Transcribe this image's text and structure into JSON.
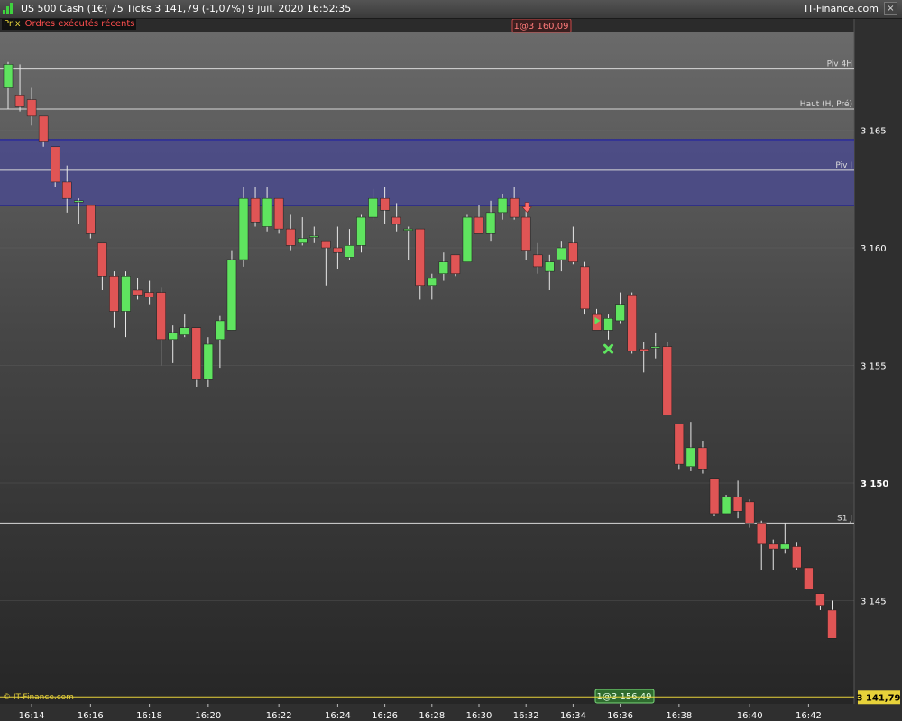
{
  "header": {
    "title": "US 500 Cash (1€)   75 Ticks   3 141,79 (-1,07%)   9 juil. 2020 16:52:35",
    "brand": "IT-Finance.com",
    "close_icon": "close-icon"
  },
  "tags": {
    "price": "Prix",
    "orders": "Ordres exécutés récents"
  },
  "orders": {
    "top": "1@3 160,09",
    "bottom": "1@3 156,49"
  },
  "footer_brand": "© IT-Finance.com",
  "colors": {
    "up": "#5fe45f",
    "down": "#e05555",
    "pivot_zone": "#4a4a8c",
    "price_line": "#e7d23a"
  },
  "chart_data": {
    "type": "candlestick",
    "instrument": "US 500 Cash (1€)",
    "interval": "75 Ticks",
    "last_price": "3 141,79",
    "last_price_value": 3141.79,
    "y_ticks": [
      {
        "v": 3165,
        "label": "3 165",
        "bold": false
      },
      {
        "v": 3160,
        "label": "3 160",
        "bold": false
      },
      {
        "v": 3155,
        "label": "3 155",
        "bold": false
      },
      {
        "v": 3150,
        "label": "3 150",
        "bold": true
      },
      {
        "v": 3145,
        "label": "3 145",
        "bold": false
      }
    ],
    "x_labels": [
      {
        "i": 2,
        "label": "16:14"
      },
      {
        "i": 7,
        "label": "16:16"
      },
      {
        "i": 12,
        "label": "16:18"
      },
      {
        "i": 17,
        "label": "16:20"
      },
      {
        "i": 23,
        "label": "16:22"
      },
      {
        "i": 28,
        "label": "16:24"
      },
      {
        "i": 32,
        "label": "16:26"
      },
      {
        "i": 36,
        "label": "16:28"
      },
      {
        "i": 40,
        "label": "16:30"
      },
      {
        "i": 44,
        "label": "16:32"
      },
      {
        "i": 48,
        "label": "16:34"
      },
      {
        "i": 52,
        "label": "16:36"
      },
      {
        "i": 57,
        "label": "16:38"
      },
      {
        "i": 63,
        "label": "16:40"
      },
      {
        "i": 68,
        "label": "16:42"
      }
    ],
    "levels": [
      {
        "name": "Piv 4H",
        "value": 3167.6
      },
      {
        "name": "Haut (H, Pré)",
        "value": 3165.9
      },
      {
        "name": "Piv J",
        "value": 3163.3
      },
      {
        "name": "S1 J",
        "value": 3148.3
      }
    ],
    "zone": {
      "top": 3164.6,
      "bottom": 3161.8
    },
    "candles": [
      {
        "o": 3166.8,
        "h": 3167.9,
        "l": 3165.9,
        "c": 3167.8
      },
      {
        "o": 3166.5,
        "h": 3167.8,
        "l": 3165.8,
        "c": 3166.0
      },
      {
        "o": 3166.3,
        "h": 3166.8,
        "l": 3165.2,
        "c": 3165.6
      },
      {
        "o": 3165.6,
        "h": 3165.6,
        "l": 3164.3,
        "c": 3164.5
      },
      {
        "o": 3164.3,
        "h": 3164.3,
        "l": 3162.6,
        "c": 3162.8
      },
      {
        "o": 3162.8,
        "h": 3163.5,
        "l": 3161.5,
        "c": 3162.1
      },
      {
        "o": 3162.0,
        "h": 3162.1,
        "l": 3161.0,
        "c": 3162.0
      },
      {
        "o": 3161.8,
        "h": 3161.8,
        "l": 3160.4,
        "c": 3160.6
      },
      {
        "o": 3160.2,
        "h": 3160.2,
        "l": 3158.2,
        "c": 3158.8
      },
      {
        "o": 3158.8,
        "h": 3159.0,
        "l": 3156.6,
        "c": 3157.3
      },
      {
        "o": 3157.3,
        "h": 3159.0,
        "l": 3156.2,
        "c": 3158.8
      },
      {
        "o": 3158.2,
        "h": 3158.7,
        "l": 3157.8,
        "c": 3158.0
      },
      {
        "o": 3158.1,
        "h": 3158.6,
        "l": 3157.6,
        "c": 3157.9
      },
      {
        "o": 3158.1,
        "h": 3158.3,
        "l": 3155.0,
        "c": 3156.1
      },
      {
        "o": 3156.1,
        "h": 3156.7,
        "l": 3155.1,
        "c": 3156.4
      },
      {
        "o": 3156.3,
        "h": 3157.2,
        "l": 3156.2,
        "c": 3156.6
      },
      {
        "o": 3156.6,
        "h": 3156.6,
        "l": 3154.1,
        "c": 3154.4
      },
      {
        "o": 3154.4,
        "h": 3156.2,
        "l": 3154.1,
        "c": 3155.9
      },
      {
        "o": 3156.1,
        "h": 3157.1,
        "l": 3154.9,
        "c": 3156.9
      },
      {
        "o": 3156.5,
        "h": 3159.9,
        "l": 3156.5,
        "c": 3159.5
      },
      {
        "o": 3159.5,
        "h": 3162.6,
        "l": 3159.2,
        "c": 3162.1
      },
      {
        "o": 3162.1,
        "h": 3162.6,
        "l": 3160.9,
        "c": 3161.1
      },
      {
        "o": 3160.9,
        "h": 3162.6,
        "l": 3160.7,
        "c": 3162.1
      },
      {
        "o": 3162.1,
        "h": 3162.1,
        "l": 3160.6,
        "c": 3160.8
      },
      {
        "o": 3160.8,
        "h": 3161.4,
        "l": 3159.9,
        "c": 3160.1
      },
      {
        "o": 3160.2,
        "h": 3161.3,
        "l": 3160.1,
        "c": 3160.4
      },
      {
        "o": 3160.5,
        "h": 3160.9,
        "l": 3160.2,
        "c": 3160.5
      },
      {
        "o": 3160.3,
        "h": 3160.3,
        "l": 3158.4,
        "c": 3160.0
      },
      {
        "o": 3160.0,
        "h": 3160.9,
        "l": 3159.1,
        "c": 3159.8
      },
      {
        "o": 3159.6,
        "h": 3160.8,
        "l": 3159.5,
        "c": 3160.1
      },
      {
        "o": 3160.1,
        "h": 3161.4,
        "l": 3159.8,
        "c": 3161.3
      },
      {
        "o": 3161.3,
        "h": 3162.5,
        "l": 3161.2,
        "c": 3162.1
      },
      {
        "o": 3162.1,
        "h": 3162.6,
        "l": 3161.0,
        "c": 3161.6
      },
      {
        "o": 3161.3,
        "h": 3161.9,
        "l": 3160.7,
        "c": 3161.0
      },
      {
        "o": 3160.8,
        "h": 3160.9,
        "l": 3159.5,
        "c": 3160.8
      },
      {
        "o": 3160.8,
        "h": 3160.8,
        "l": 3157.8,
        "c": 3158.4
      },
      {
        "o": 3158.4,
        "h": 3158.9,
        "l": 3157.8,
        "c": 3158.7
      },
      {
        "o": 3158.9,
        "h": 3159.8,
        "l": 3158.6,
        "c": 3159.4
      },
      {
        "o": 3159.7,
        "h": 3159.7,
        "l": 3158.8,
        "c": 3158.9
      },
      {
        "o": 3159.4,
        "h": 3161.4,
        "l": 3159.4,
        "c": 3161.3
      },
      {
        "o": 3161.3,
        "h": 3161.8,
        "l": 3160.6,
        "c": 3160.6
      },
      {
        "o": 3160.6,
        "h": 3162.0,
        "l": 3160.3,
        "c": 3161.5
      },
      {
        "o": 3161.5,
        "h": 3162.3,
        "l": 3161.2,
        "c": 3162.1
      },
      {
        "o": 3162.1,
        "h": 3162.6,
        "l": 3161.2,
        "c": 3161.3
      },
      {
        "o": 3161.3,
        "h": 3161.6,
        "l": 3159.5,
        "c": 3159.9
      },
      {
        "o": 3159.7,
        "h": 3160.2,
        "l": 3158.9,
        "c": 3159.2
      },
      {
        "o": 3159.0,
        "h": 3159.7,
        "l": 3158.2,
        "c": 3159.4
      },
      {
        "o": 3159.5,
        "h": 3160.3,
        "l": 3159.0,
        "c": 3160.0
      },
      {
        "o": 3160.2,
        "h": 3160.9,
        "l": 3159.3,
        "c": 3159.4
      },
      {
        "o": 3159.2,
        "h": 3159.4,
        "l": 3157.2,
        "c": 3157.4
      },
      {
        "o": 3157.2,
        "h": 3157.4,
        "l": 3156.6,
        "c": 3156.5
      },
      {
        "o": 3156.5,
        "h": 3157.2,
        "l": 3156.1,
        "c": 3157.0
      },
      {
        "o": 3156.9,
        "h": 3158.1,
        "l": 3156.8,
        "c": 3157.6
      },
      {
        "o": 3158.0,
        "h": 3158.1,
        "l": 3155.5,
        "c": 3155.6
      },
      {
        "o": 3155.7,
        "h": 3156.0,
        "l": 3154.7,
        "c": 3155.6
      },
      {
        "o": 3155.8,
        "h": 3156.4,
        "l": 3155.3,
        "c": 3155.8
      },
      {
        "o": 3155.8,
        "h": 3156.0,
        "l": 3152.9,
        "c": 3152.9
      },
      {
        "o": 3152.5,
        "h": 3152.5,
        "l": 3150.6,
        "c": 3150.8
      },
      {
        "o": 3150.7,
        "h": 3152.6,
        "l": 3150.5,
        "c": 3151.5
      },
      {
        "o": 3151.5,
        "h": 3151.8,
        "l": 3150.4,
        "c": 3150.6
      },
      {
        "o": 3150.2,
        "h": 3150.2,
        "l": 3148.6,
        "c": 3148.7
      },
      {
        "o": 3148.7,
        "h": 3149.5,
        "l": 3148.7,
        "c": 3149.4
      },
      {
        "o": 3149.4,
        "h": 3150.1,
        "l": 3148.5,
        "c": 3148.8
      },
      {
        "o": 3149.2,
        "h": 3149.3,
        "l": 3148.1,
        "c": 3148.3
      },
      {
        "o": 3148.3,
        "h": 3148.4,
        "l": 3146.3,
        "c": 3147.4
      },
      {
        "o": 3147.4,
        "h": 3147.6,
        "l": 3146.3,
        "c": 3147.2
      },
      {
        "o": 3147.2,
        "h": 3148.3,
        "l": 3147.0,
        "c": 3147.4
      },
      {
        "o": 3147.3,
        "h": 3147.5,
        "l": 3146.3,
        "c": 3146.4
      },
      {
        "o": 3146.4,
        "h": 3146.4,
        "l": 3145.5,
        "c": 3145.5
      },
      {
        "o": 3145.3,
        "h": 3145.3,
        "l": 3144.6,
        "c": 3144.8
      },
      {
        "o": 3144.6,
        "h": 3145.0,
        "l": 3143.4,
        "c": 3143.4
      }
    ],
    "markers": [
      {
        "type": "sell-arrow",
        "i": 44,
        "price": 3161.7
      },
      {
        "type": "buy-triangle",
        "i": 50,
        "price": 3156.9
      },
      {
        "type": "cross",
        "i": 51,
        "price": 3155.7
      }
    ]
  }
}
